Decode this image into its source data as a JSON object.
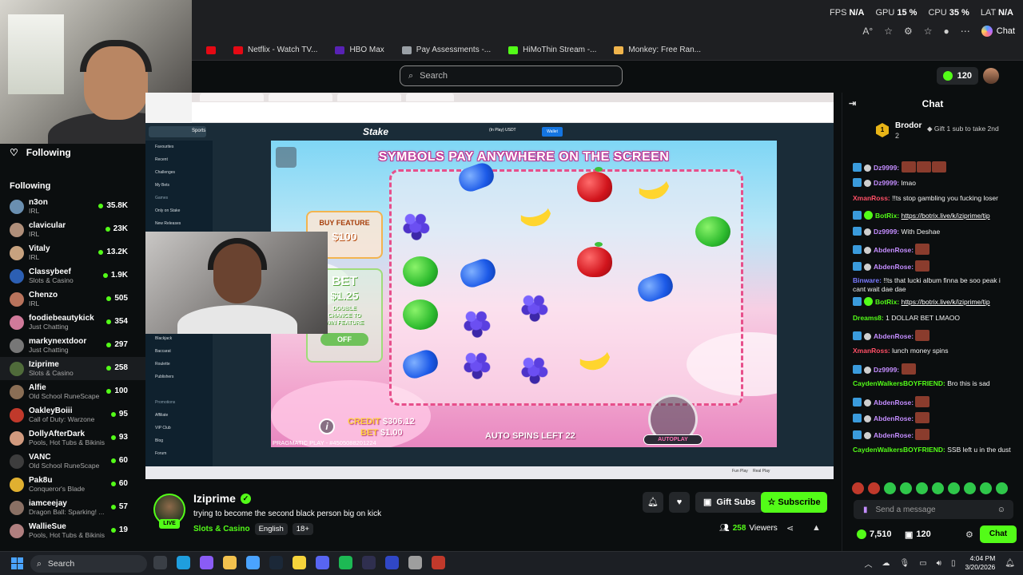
{
  "perf": {
    "fps_label": "FPS",
    "fps": "N/A",
    "gpu_label": "GPU",
    "gpu": "15 %",
    "cpu_label": "CPU",
    "cpu": "35 %",
    "lat_label": "LAT",
    "lat": "N/A"
  },
  "browser": {
    "chat_label": "Chat",
    "bookmarks": [
      {
        "label": "Netflix - Watch TV...",
        "color": "#e50914"
      },
      {
        "label": "HBO Max",
        "color": "#5822b4"
      },
      {
        "label": "Pay Assessments -...",
        "color": "#9aa0a6"
      },
      {
        "label": "HiMoThin Stream -...",
        "color": "#53fc18"
      },
      {
        "label": "Monkey: Free Ran...",
        "color": "#f0b44c"
      }
    ]
  },
  "header": {
    "search_placeholder": "Search",
    "points": "120"
  },
  "sidebar": {
    "following_label": "Following",
    "section_title": "Following",
    "channels": [
      {
        "name": "n3on",
        "category": "IRL",
        "viewers": "35.8K",
        "color": "#6a8fb0"
      },
      {
        "name": "clavicular",
        "category": "IRL",
        "viewers": "23K",
        "color": "#b08f7a"
      },
      {
        "name": "Vitaly",
        "category": "IRL",
        "viewers": "13.2K",
        "color": "#c7a27f"
      },
      {
        "name": "Classybeef",
        "category": "Slots & Casino",
        "viewers": "1.9K",
        "color": "#2c5fb3"
      },
      {
        "name": "Chenzo",
        "category": "IRL",
        "viewers": "505",
        "color": "#b8735c"
      },
      {
        "name": "foodiebeautykick",
        "category": "Just Chatting",
        "viewers": "354",
        "color": "#d07a9a"
      },
      {
        "name": "markynextdoor",
        "category": "Just Chatting",
        "viewers": "297",
        "color": "#777777"
      },
      {
        "name": "Iziprime",
        "category": "Slots & Casino",
        "viewers": "258",
        "color": "#4f6b3a",
        "active": true
      },
      {
        "name": "Alfie",
        "category": "Old School RuneScape",
        "viewers": "100",
        "color": "#8a6e55"
      },
      {
        "name": "OakleyBoiii",
        "category": "Call of Duty: Warzone",
        "viewers": "95",
        "color": "#c0392b"
      },
      {
        "name": "DollyAfterDark",
        "category": "Pools, Hot Tubs & Bikinis",
        "viewers": "93",
        "color": "#d19a7e"
      },
      {
        "name": "VANC",
        "category": "Old School RuneScape",
        "viewers": "60",
        "color": "#3d3d3d"
      },
      {
        "name": "Pak8u",
        "category": "Conqueror's Blade",
        "viewers": "60",
        "color": "#e0b030"
      },
      {
        "name": "iamceejay",
        "category": "Dragon Ball: Sparking! ...",
        "viewers": "57",
        "color": "#8a7064"
      },
      {
        "name": "WallieSue",
        "category": "Pools, Hot Tubs & Bikinis",
        "viewers": "19",
        "color": "#b07f7f"
      }
    ]
  },
  "stake": {
    "logo": "Stake",
    "sports": "Sports",
    "wallet": "Wallet",
    "currency": "(In Play) USDT",
    "sidebar_items": [
      "Favourites",
      "Recent",
      "Challenges",
      "My Bets",
      "Games",
      "Only on Stake",
      "New Releases",
      "",
      "",
      "",
      "",
      "",
      "",
      "",
      "Bonus Buy",
      "Blackjack",
      "Baccarat",
      "Roulette",
      "Publishers",
      "",
      "Promotions",
      "Affiliate",
      "VIP Club",
      "Blog",
      "Forum"
    ],
    "fun_play": "Fun Play",
    "real_play": "Real Play"
  },
  "game": {
    "title": "SYMBOLS PAY ANYWHERE ON THE SCREEN",
    "buy_feature_label": "BUY FEATURE",
    "buy_feature_price": "$100",
    "ante_bet_label": "BET",
    "ante_bet_amount": "$1.25",
    "ante_text_1": "DOUBLE",
    "ante_text_2": "CHANCE TO",
    "ante_text_3": "WIN FEATURE",
    "ante_toggle": "OFF",
    "credit_label": "CREDIT",
    "credit": "$306.12",
    "bet_label": "BET",
    "bet": "$1.00",
    "provider": "PRAGMATIC PLAY - #4505088201224",
    "auto_spins": "AUTO SPINS LEFT 22",
    "autoplay": "AUTOPLAY",
    "info": "i"
  },
  "stream": {
    "streamer": "Iziprime",
    "live": "LIVE",
    "title": "trying to become the second black person big on kick",
    "category": "Slots & Casino",
    "tags": [
      "English",
      "18+"
    ],
    "gift_subs": "Gift Subs",
    "subscribe": "Subscribe",
    "viewers": "258",
    "viewers_label": "Viewers"
  },
  "chat": {
    "title": "Chat",
    "pinned_rank": "1",
    "pinned_user": "Brodor",
    "pinned_count": "2",
    "pinned_cta": "Gift 1 sub to take 2nd",
    "messages": [
      {
        "user": "Dz9999:",
        "color": "u-purple",
        "badges": [
          "b-blue",
          "b-grey"
        ],
        "text": "",
        "emotes": 3
      },
      {
        "user": "Dz9999:",
        "color": "u-purple",
        "badges": [
          "b-blue",
          "b-grey"
        ],
        "text": "lmao"
      },
      {
        "user": "XmanRoss:",
        "color": "u-red",
        "badges": [],
        "text": "!!ts stop gambling you fucking loser"
      },
      {
        "user": "BotRix:",
        "color": "u-green",
        "badges": [
          "b-blue",
          "b-green"
        ],
        "text": "https://botrix.live/k/iziprime/tip",
        "link": true
      },
      {
        "user": "Dz9999:",
        "color": "u-purple",
        "badges": [
          "b-blue",
          "b-grey"
        ],
        "text": "With Deshae"
      },
      {
        "user": "AbdenRose:",
        "color": "u-purple",
        "badges": [
          "b-blue",
          "b-grey"
        ],
        "text": "",
        "emotes": 1
      },
      {
        "user": "AbdenRose:",
        "color": "u-purple",
        "badges": [
          "b-blue",
          "b-grey"
        ],
        "text": "",
        "emotes": 1
      },
      {
        "user": "Binware:",
        "color": "u-blue",
        "badges": [],
        "text": "!!ts that lucki album finna be soo peak i cant wait dae dae"
      },
      {
        "user": "BotRix:",
        "color": "u-green",
        "badges": [
          "b-blue",
          "b-green"
        ],
        "text": "https://botrix.live/k/iziprime/tip",
        "link": true
      },
      {
        "user": "Dreams8:",
        "color": "u-green",
        "badges": [],
        "text": "1 DOLLAR BET LMAOO"
      },
      {
        "user": "AbdenRose:",
        "color": "u-purple",
        "badges": [
          "b-blue",
          "b-grey"
        ],
        "text": "",
        "emotes": 1
      },
      {
        "user": "XmanRoss:",
        "color": "u-red",
        "badges": [],
        "text": "lunch money spins"
      },
      {
        "user": "Dz9999:",
        "color": "u-purple",
        "badges": [
          "b-blue",
          "b-grey"
        ],
        "text": "",
        "emotes": 1
      },
      {
        "user": "CaydenWalkersBOYFRIEND:",
        "color": "u-green",
        "badges": [],
        "text": "Bro this is sad"
      },
      {
        "user": "AbdenRose:",
        "color": "u-purple",
        "badges": [
          "b-blue",
          "b-grey"
        ],
        "text": "",
        "emotes": 1
      },
      {
        "user": "AbdenRose:",
        "color": "u-purple",
        "badges": [
          "b-blue",
          "b-grey"
        ],
        "text": "",
        "emotes": 1
      },
      {
        "user": "AbdenRose:",
        "color": "u-purple",
        "badges": [
          "b-blue",
          "b-grey"
        ],
        "text": "",
        "emotes": 1
      },
      {
        "user": "CaydenWalkersBOYFRIEND:",
        "color": "u-green",
        "badges": [],
        "text": "SSB left u in the dust"
      }
    ],
    "input_placeholder": "Send a message",
    "points": "7,510",
    "gifts": "120",
    "send": "Chat"
  },
  "taskbar": {
    "search": "Search",
    "time": "4:04 PM",
    "date": "3/20/2026"
  }
}
